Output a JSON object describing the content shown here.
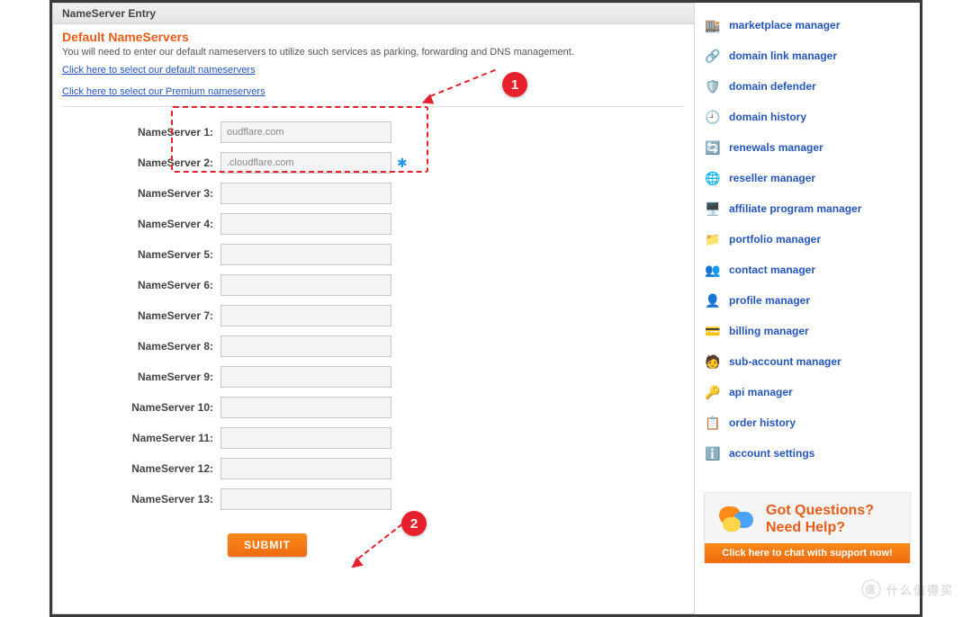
{
  "panel": {
    "title": "NameServer Entry",
    "section_title": "Default NameServers",
    "description": "You will need to enter our default nameservers to utilize such services as parking, forwarding and DNS management.",
    "link_default": "Click here to select our default nameservers",
    "link_premium": "Click here to select our Premium nameservers"
  },
  "nameservers": [
    {
      "label": "NameServer 1:",
      "value": "oudflare.com"
    },
    {
      "label": "NameServer 2:",
      "value": ".cloudflare.com"
    },
    {
      "label": "NameServer 3:",
      "value": ""
    },
    {
      "label": "NameServer 4:",
      "value": ""
    },
    {
      "label": "NameServer 5:",
      "value": ""
    },
    {
      "label": "NameServer 6:",
      "value": ""
    },
    {
      "label": "NameServer 7:",
      "value": ""
    },
    {
      "label": "NameServer 8:",
      "value": ""
    },
    {
      "label": "NameServer 9:",
      "value": ""
    },
    {
      "label": "NameServer 10:",
      "value": ""
    },
    {
      "label": "NameServer 11:",
      "value": ""
    },
    {
      "label": "NameServer 12:",
      "value": ""
    },
    {
      "label": "NameServer 13:",
      "value": ""
    }
  ],
  "submit_label": "SUBMIT",
  "annotations": {
    "badge1": "1",
    "badge2": "2"
  },
  "sidebar": {
    "items": [
      {
        "icon": "🏬",
        "label": "marketplace manager"
      },
      {
        "icon": "🔗",
        "label": "domain link manager"
      },
      {
        "icon": "🛡️",
        "label": "domain defender"
      },
      {
        "icon": "🕘",
        "label": "domain history"
      },
      {
        "icon": "🔄",
        "label": "renewals manager"
      },
      {
        "icon": "🌐",
        "label": "reseller manager"
      },
      {
        "icon": "🖥️",
        "label": "affiliate program manager"
      },
      {
        "icon": "📁",
        "label": "portfolio manager"
      },
      {
        "icon": "👥",
        "label": "contact manager"
      },
      {
        "icon": "👤",
        "label": "profile manager"
      },
      {
        "icon": "💳",
        "label": "billing manager"
      },
      {
        "icon": "🧑",
        "label": "sub-account manager"
      },
      {
        "icon": "🔑",
        "label": "api manager"
      },
      {
        "icon": "📋",
        "label": "order history"
      },
      {
        "icon": "ℹ️",
        "label": "account settings"
      }
    ]
  },
  "help": {
    "line1": "Got Questions?",
    "line2": "Need Help?",
    "bar": "Click here to chat with support now!"
  },
  "watermark": {
    "badge": "值",
    "text": "什么值得买"
  }
}
